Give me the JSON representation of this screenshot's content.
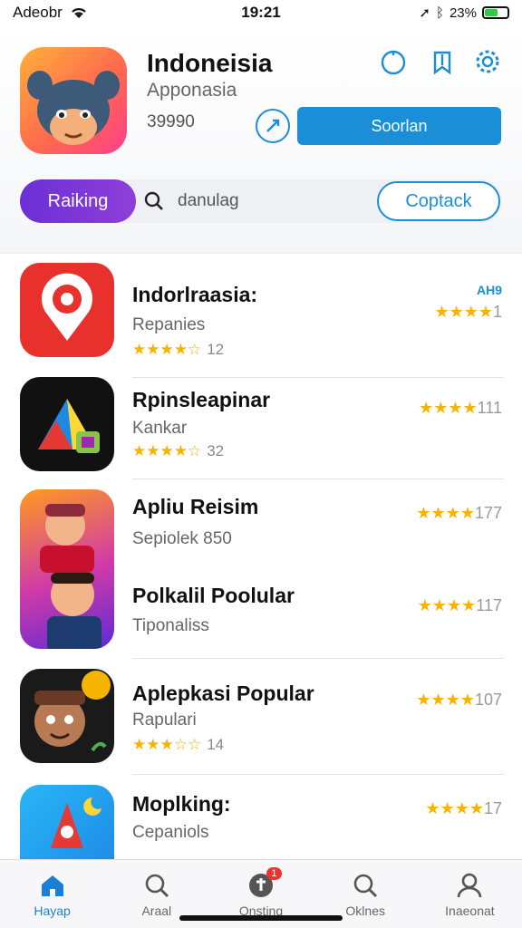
{
  "status_bar": {
    "carrier": "Adeobr",
    "time": "19:21",
    "battery": "23%"
  },
  "header": {
    "title": "Indoneisia",
    "subtitle": "Apponasia",
    "number": "39990",
    "primary_button": "Soorlan",
    "ranking_pill": "Raiking",
    "search_placeholder": "danulag",
    "contact_button": "Coptack"
  },
  "list": [
    {
      "title": "Indorlraasia:",
      "subtitle": "Repanies",
      "rating": "12",
      "right_tag": "AH9",
      "right_rating": "1",
      "stars": 4.5
    },
    {
      "title": "Rpinsleapinar",
      "subtitle": "Kankar",
      "rating": "32",
      "right_tag": "",
      "right_rating": "111",
      "stars": 4.5
    },
    {
      "title": "Apliu Reisim",
      "subtitle": "Sepiolek 850",
      "rating": "",
      "right_tag": "",
      "right_rating": "177",
      "stars": 0
    },
    {
      "title": "Polkalil Poolular",
      "subtitle": "Tiponaliss",
      "rating": "",
      "right_tag": "",
      "right_rating": "117",
      "stars": 0
    },
    {
      "title": "Aplepkasi Popular",
      "subtitle": "Rapulari",
      "rating": "14",
      "right_tag": "",
      "right_rating": "107",
      "stars": 3.5
    },
    {
      "title": "Moplking:",
      "subtitle": "Cepaniols",
      "rating": "",
      "right_tag": "",
      "right_rating": "17",
      "stars": 0
    }
  ],
  "tabbar": [
    {
      "label": "Hayap",
      "icon": "home-icon",
      "active": true
    },
    {
      "label": "Araal",
      "icon": "search-icon",
      "active": false
    },
    {
      "label": "Onsting",
      "icon": "updates-icon",
      "active": false,
      "badge": "1"
    },
    {
      "label": "Oklnes",
      "icon": "search-icon",
      "active": false
    },
    {
      "label": "Inaeonat",
      "icon": "profile-icon",
      "active": false
    }
  ],
  "colors": {
    "accent": "#1a8fd8",
    "pill": "#7a35d6",
    "star": "#f5b400"
  }
}
